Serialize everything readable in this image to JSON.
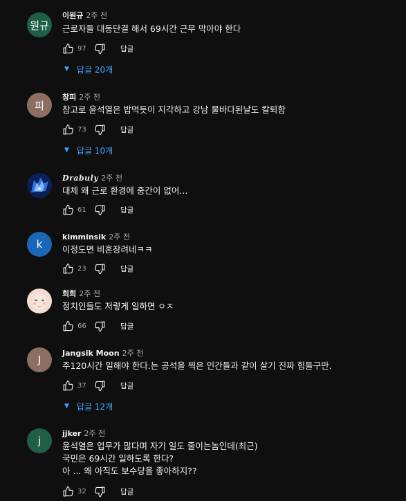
{
  "reply_label": "답글",
  "comments": [
    {
      "author": "이원규",
      "time": "2주 전",
      "avatar_text": "원규",
      "avatar_color": "#1e5f45",
      "lines": [
        "근로자들 대동단결 해서 69시간 근무 막아야 한다"
      ],
      "likes": "97",
      "replies": "답글 20개"
    },
    {
      "author": "창피",
      "time": "2주 전",
      "avatar_text": "피",
      "avatar_color": "#8d6e63",
      "lines": [
        "참고로 윤석열은 밥먹듯이 지각하고 강남 물바다된날도 칼퇴함"
      ],
      "likes": "73",
      "replies": "답글 10개"
    },
    {
      "author": "Drabuly",
      "time": "2주 전",
      "avatar_text": "",
      "avatar_color": "#0d2a6b",
      "lines": [
        "대체 왜 근로 환경에 중간이 없어..."
      ],
      "likes": "61"
    },
    {
      "author": "kimminsik",
      "time": "2주 전",
      "avatar_text": "k",
      "avatar_color": "#1a67b8",
      "lines": [
        "이정도면 비혼장려네ㅋㅋ"
      ],
      "likes": "23"
    },
    {
      "author": "희희",
      "time": "2주 전",
      "avatar_text": "",
      "avatar_color": "#e8cfc2",
      "lines": [
        "정치인들도 저렇게 일하면 ㅇㅈ"
      ],
      "likes": "66"
    },
    {
      "author": "Jangsik Moon",
      "time": "2주 전",
      "avatar_text": "J",
      "avatar_color": "#8d6e63",
      "lines": [
        "주120시간 일해야 한다.는 공석을 찍은 인간들과 같이 살기 진짜 힘들구만."
      ],
      "likes": "37",
      "replies": "답글 12개"
    },
    {
      "author": "jjker",
      "time": "2주 전",
      "avatar_text": "j",
      "avatar_color": "#1e5f45",
      "lines": [
        "윤석열은 업무가 많다며 자기 일도 줄이는놈인데(최근)",
        "국민은 69시간 일하도록 한다?",
        "아 ... 왜 아직도 보수당을 좋아하지??"
      ],
      "likes": "32"
    }
  ]
}
